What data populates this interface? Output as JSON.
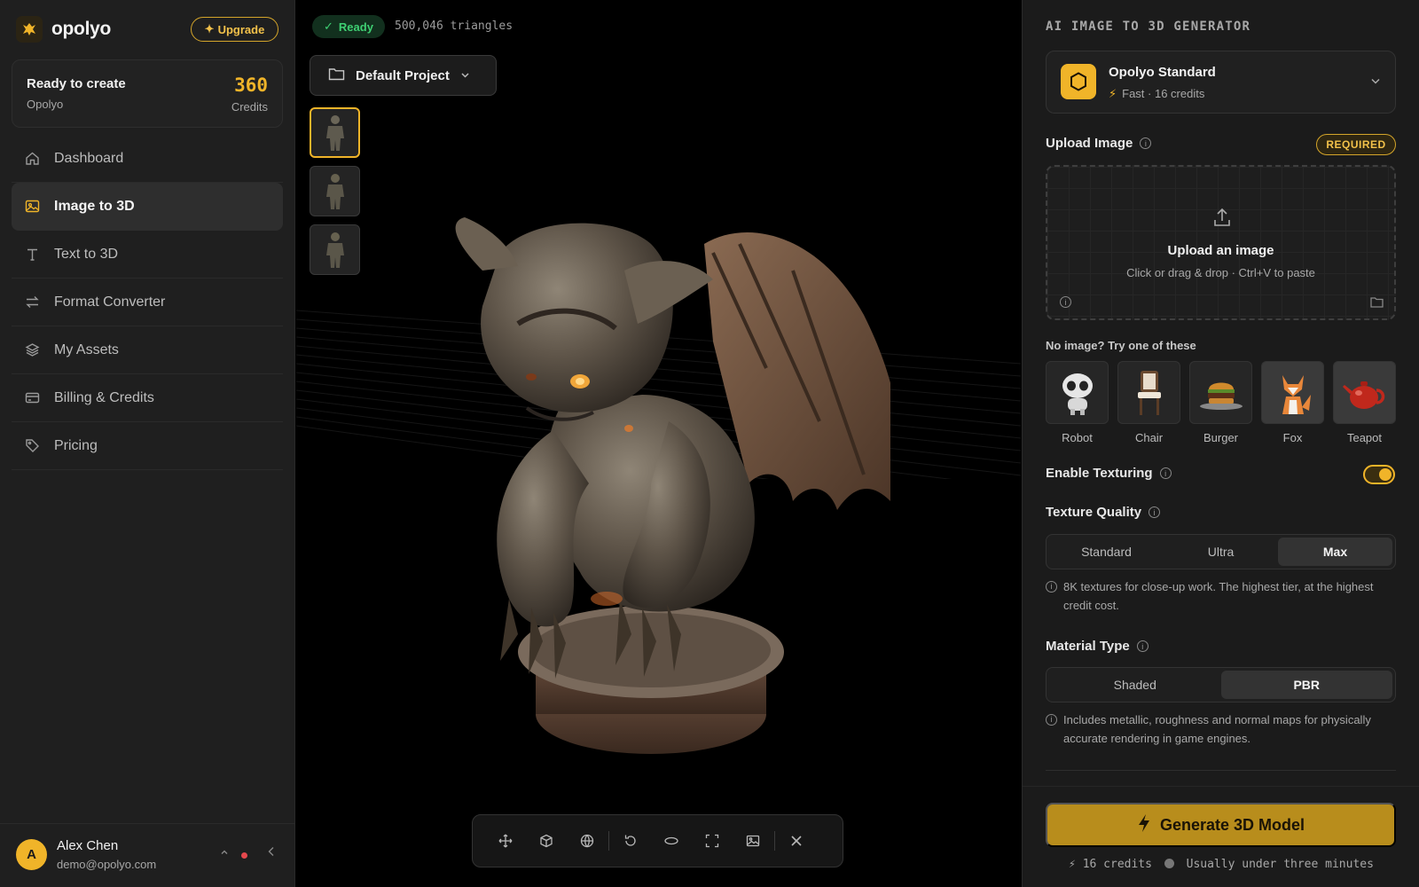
{
  "brand": {
    "name": "opolyo",
    "upgrade_label": "Upgrade"
  },
  "credits_card": {
    "title": "Ready to create",
    "subtitle": "Opolyo",
    "amount": "360",
    "unit": "Credits"
  },
  "nav": [
    {
      "label": "Dashboard",
      "icon": "home-icon"
    },
    {
      "label": "Image to 3D",
      "icon": "image-icon",
      "active": true
    },
    {
      "label": "Text to 3D",
      "icon": "text-icon"
    },
    {
      "label": "Format Converter",
      "icon": "swap-icon"
    },
    {
      "label": "My Assets",
      "icon": "layers-icon"
    },
    {
      "label": "Billing & Credits",
      "icon": "credit-card-icon"
    },
    {
      "label": "Pricing",
      "icon": "tag-icon"
    }
  ],
  "user": {
    "initial": "A",
    "name": "Alex Chen",
    "email": "demo@opolyo.com"
  },
  "viewport": {
    "status": "Ready",
    "triangles": "500,046 triangles",
    "project": "Default Project",
    "thumbnail_count": 3,
    "selected_thumbnail": 1,
    "toolbar": [
      "move-icon",
      "cube-icon",
      "globe-icon",
      "rotate-icon",
      "orbit-icon",
      "fullscreen-icon",
      "image-icon",
      "close-icon"
    ]
  },
  "panel": {
    "title": "AI IMAGE TO 3D GENERATOR",
    "model": {
      "name": "Opolyo Standard",
      "meta": "Fast · 16 credits"
    },
    "upload": {
      "label": "Upload Image",
      "required": "REQUIRED",
      "title": "Upload an image",
      "hint": "Click or drag & drop · Ctrl+V to paste"
    },
    "samples_label": "No image? Try one of these",
    "samples": [
      "Robot",
      "Chair",
      "Burger",
      "Fox",
      "Teapot"
    ],
    "texturing": {
      "label": "Enable Texturing",
      "enabled": true
    },
    "texture_quality": {
      "label": "Texture Quality",
      "options": [
        "Standard",
        "Ultra",
        "Max"
      ],
      "selected": "Max",
      "note": "8K textures for close-up work. The highest tier, at the highest credit cost."
    },
    "material_type": {
      "label": "Material Type",
      "options": [
        "Shaded",
        "PBR"
      ],
      "selected": "PBR",
      "note": "Includes metallic, roughness and normal maps for physically accurate rendering in game engines."
    },
    "generate": {
      "label": "Generate 3D Model",
      "credits": "16 credits",
      "eta": "Usually under three minutes"
    }
  },
  "colors": {
    "accent": "#f0b429",
    "ready_green": "#3ecf72",
    "panel_bg": "#1b1b1b",
    "sidebar_bg": "#1f1f1f"
  }
}
